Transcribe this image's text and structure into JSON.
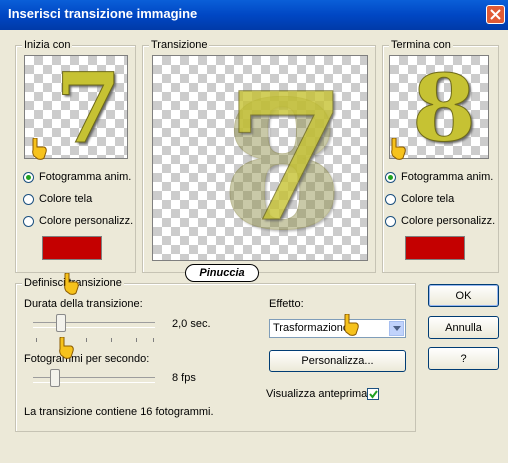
{
  "window": {
    "title": "Inserisci transizione immagine"
  },
  "start": {
    "group_label": "Inizia con",
    "digit": "7",
    "options": [
      "Fotogramma anim.",
      "Colore tela",
      "Colore personalizz."
    ],
    "selected": 0,
    "custom_color": "#c40000"
  },
  "transition": {
    "group_label": "Transizione",
    "digit_front": "7",
    "digit_back": "8"
  },
  "end": {
    "group_label": "Termina con",
    "digit": "8",
    "options": [
      "Fotogramma anim.",
      "Colore tela",
      "Colore personalizz."
    ],
    "selected": 0,
    "custom_color": "#c40000"
  },
  "definition": {
    "group_label": "Definisci transizione",
    "duration_label": "Durata della transizione:",
    "duration_value": "2,0 sec.",
    "fps_label": "Fotogrammi per secondo:",
    "fps_value": "8 fps",
    "summary": "La transizione contiene 16 fotogrammi.",
    "effect_label": "Effetto:",
    "effect_value": "Trasformazione",
    "customize_label": "Personalizza...",
    "preview_label": "Visualizza anteprima",
    "preview_checked": true
  },
  "buttons": {
    "ok": "OK",
    "cancel": "Annulla",
    "help": "?"
  },
  "watermark": "Pinuccia",
  "icons": [
    "close-icon",
    "pointing-hand-icon",
    "dropdown-arrow-icon",
    "checkmark-icon"
  ]
}
